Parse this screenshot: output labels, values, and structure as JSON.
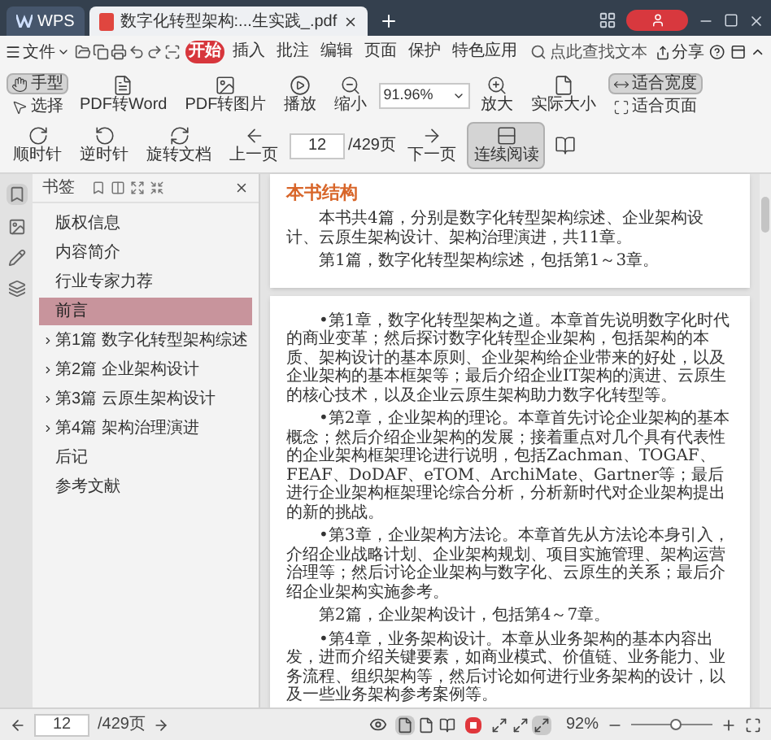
{
  "title_bar": {
    "app_tab": "WPS",
    "doc_tab": {
      "title": "数字化转型架构:...生实践_.pdf"
    }
  },
  "menu": {
    "file": "文件",
    "tabs": [
      {
        "label": "开始",
        "selected": true
      },
      {
        "label": "插入",
        "selected": false
      },
      {
        "label": "批注",
        "selected": false
      },
      {
        "label": "编辑",
        "selected": false
      },
      {
        "label": "页面",
        "selected": false
      },
      {
        "label": "保护",
        "selected": false
      },
      {
        "label": "特色应用",
        "selected": false
      }
    ],
    "search": {
      "placeholder": "点此查找文本"
    },
    "share": "分享"
  },
  "toolbar": [
    {
      "kind": "pair",
      "items": [
        {
          "label": "手型",
          "selected": true
        },
        {
          "label": "选择",
          "selected": false
        }
      ]
    },
    {
      "kind": "button",
      "label": "PDF转Word",
      "selected": false
    },
    {
      "kind": "button",
      "label": "PDF转图片",
      "selected": false
    },
    {
      "kind": "button",
      "label": "播放",
      "selected": false
    },
    {
      "kind": "button",
      "label": "缩小",
      "selected": false
    },
    {
      "kind": "zoom_field",
      "value": "91.96%"
    },
    {
      "kind": "button",
      "label": "放大",
      "selected": false
    },
    {
      "kind": "button",
      "label": "实际大小",
      "selected": false
    },
    {
      "kind": "pair",
      "items": [
        {
          "label": "适合宽度",
          "selected": true
        },
        {
          "label": "适合页面",
          "selected": false
        }
      ]
    },
    {
      "kind": "button",
      "label": "顺时针",
      "selected": false
    },
    {
      "kind": "button",
      "label": "逆时针",
      "selected": false
    },
    {
      "kind": "button",
      "label": "旋转文档",
      "selected": false
    },
    {
      "kind": "button",
      "label": "上一页",
      "selected": false
    },
    {
      "kind": "page_field",
      "value": "12",
      "total": "/429页"
    },
    {
      "kind": "button",
      "label": "下一页",
      "selected": false
    },
    {
      "kind": "button",
      "label": "连续阅读",
      "selected": true
    },
    {
      "kind": "icon_button",
      "selected": false
    }
  ],
  "sidebar": {
    "title": "书签",
    "items": [
      {
        "label": "版权信息",
        "selected": false
      },
      {
        "label": "内容简介",
        "selected": false
      },
      {
        "label": "行业专家力荐",
        "selected": false
      },
      {
        "label": "前言",
        "selected": true
      },
      {
        "label": "第1篇 数字化转型架构综述",
        "selected": false,
        "expanded": false
      },
      {
        "label": "第2篇 企业架构设计",
        "selected": false,
        "expanded": false
      },
      {
        "label": "第3篇 云原生架构设计",
        "selected": false,
        "expanded": false
      },
      {
        "label": "第4篇 架构治理演进",
        "selected": false,
        "expanded": false
      },
      {
        "label": "后记",
        "selected": false
      },
      {
        "label": "参考文献",
        "selected": false
      }
    ]
  },
  "document": {
    "pages": [
      {
        "blocks": [
          {
            "kind": "heading",
            "text": "本书结构"
          },
          {
            "kind": "paragraph",
            "text": "本书共4篇，分别是数字化转型架构综述、企业架构设计、云原生架构设计、架构治理演进，共11章。"
          },
          {
            "kind": "paragraph",
            "text": "第1篇，数字化转型架构综述，包括第1～3章。"
          }
        ]
      },
      {
        "blocks": [
          {
            "kind": "paragraph",
            "text": "•第1章，数字化转型架构之道。本章首先说明数字化时代的商业变革；然后探讨数字化转型企业架构，包括架构的本质、架构设计的基本原则、企业架构给企业带来的好处，以及企业架构的基本框架等；最后介绍企业IT架构的演进、云原生的核心技术，以及企业云原生架构助力数字化转型等。"
          },
          {
            "kind": "paragraph",
            "text": "•第2章，企业架构的理论。本章首先讨论企业架构的基本概念；然后介绍企业架构的发展；接着重点对几个具有代表性的企业架构框架理论进行说明，包括Zachman、TOGAF、FEAF、DoDAF、eTOM、ArchiMate、Gartner等；最后进行企业架构框架理论综合分析，分析新时代对企业架构提出的新的挑战。"
          },
          {
            "kind": "paragraph",
            "text": "•第3章，企业架构方法论。本章首先从方法论本身引入，介绍企业战略计划、企业架构规划、项目实施管理、架构运营治理等；然后讨论企业架构与数字化、云原生的关系；最后介绍企业架构实施参考。"
          },
          {
            "kind": "paragraph",
            "text": "第2篇，企业架构设计，包括第4～7章。"
          },
          {
            "kind": "paragraph",
            "text": "•第4章，业务架构设计。本章从业务架构的基本内容出发，进而介绍关键要素，如商业模式、价值链、业务能力、业务流程、组织架构等，然后讨论如何进行业务架构的设计，以及一些业务架构参考案例等。"
          }
        ]
      }
    ]
  },
  "status_bar": {
    "page": "12",
    "total": "/429页",
    "view_modes": [
      {
        "selected": true
      },
      {
        "selected": false
      },
      {
        "selected": false
      }
    ],
    "layouts": [
      {
        "selected": false
      },
      {
        "selected": false
      },
      {
        "selected": true
      }
    ],
    "zoom": "92%",
    "zoom_slider": {
      "level": 0.55
    }
  }
}
